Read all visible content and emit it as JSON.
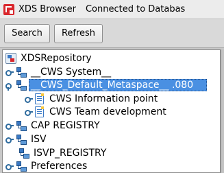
{
  "window": {
    "title": "XDS Browser",
    "status": "Connected to Databas",
    "icon": "app-icon"
  },
  "toolbar": {
    "search_label": "Search",
    "refresh_label": "Refresh"
  },
  "tree": {
    "root": "XDSRepository",
    "items": [
      {
        "label": "__CWS System__",
        "icon": "node-icon",
        "expanded": false
      },
      {
        "label": "__CWS_Default_Metaspace__ .080",
        "icon": "node-icon",
        "expanded": true,
        "selected": true
      },
      {
        "label": "CWS Information point",
        "icon": "document-icon",
        "expanded": false
      },
      {
        "label": "CWS Team development",
        "icon": "document-icon",
        "expanded": false
      },
      {
        "label": "CAP REGISTRY",
        "icon": "node-icon",
        "expanded": false
      },
      {
        "label": "ISV",
        "icon": "node-icon",
        "expanded": false
      },
      {
        "label": "ISVP_REGISTRY",
        "icon": "node-icon",
        "expanded": false
      },
      {
        "label": "Preferences",
        "icon": "node-icon",
        "expanded": false
      }
    ]
  },
  "colors": {
    "selection": "#4a90e2",
    "accent": "#d9262c",
    "icon_blue": "#3a79c5"
  }
}
